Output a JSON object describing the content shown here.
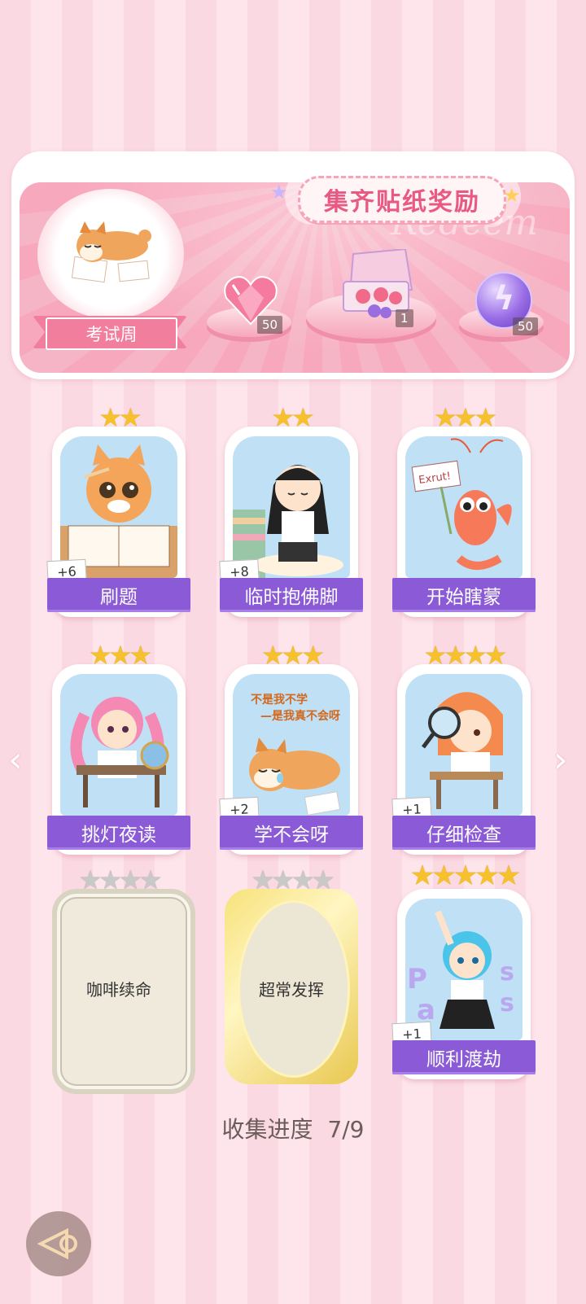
{
  "header": {
    "title": "集齐贴纸奖励",
    "watermark": "Redeem",
    "theme_label": "考试周",
    "rewards": [
      {
        "icon": "heart-gem-icon",
        "count": "50"
      },
      {
        "icon": "gift-box-icon",
        "count": "1"
      },
      {
        "icon": "lightning-orb-icon",
        "count": "50"
      }
    ]
  },
  "cards": [
    {
      "label": "刷题",
      "stars": 2,
      "bonus": "+6",
      "collected": true,
      "art": "cat-writing"
    },
    {
      "label": "临时抱佛脚",
      "stars": 2,
      "bonus": "+8",
      "collected": true,
      "art": "girl-praying"
    },
    {
      "label": "开始瞎蒙",
      "stars": 3,
      "bonus": "",
      "collected": true,
      "art": "shrimp-sign",
      "sign_text": "Exrut!"
    },
    {
      "label": "挑灯夜读",
      "stars": 3,
      "bonus": "",
      "collected": true,
      "art": "girl-globe"
    },
    {
      "label": "学不会呀",
      "stars": 3,
      "bonus": "+2",
      "collected": true,
      "art": "shiba-crying",
      "art_text_1": "不是我不学",
      "art_text_2": "—是我真不会呀"
    },
    {
      "label": "仔细检查",
      "stars": 4,
      "bonus": "+1",
      "collected": true,
      "art": "girl-magnifier"
    },
    {
      "label": "咖啡续命",
      "stars": 4,
      "bonus": "",
      "collected": false,
      "art": "locked-silver"
    },
    {
      "label": "超常发挥",
      "stars": 4,
      "bonus": "",
      "collected": false,
      "art": "locked-gold"
    },
    {
      "label": "顺利渡劫",
      "stars": 5,
      "bonus": "+1",
      "collected": true,
      "art": "girl-pass",
      "art_letters": [
        "P",
        "a",
        "s",
        "s"
      ]
    }
  ],
  "progress": {
    "label": "收集进度",
    "value": "7/9"
  },
  "colors": {
    "accent": "#8b5ad6",
    "pink": "#f27e9e",
    "gold": "#f6c12c"
  }
}
